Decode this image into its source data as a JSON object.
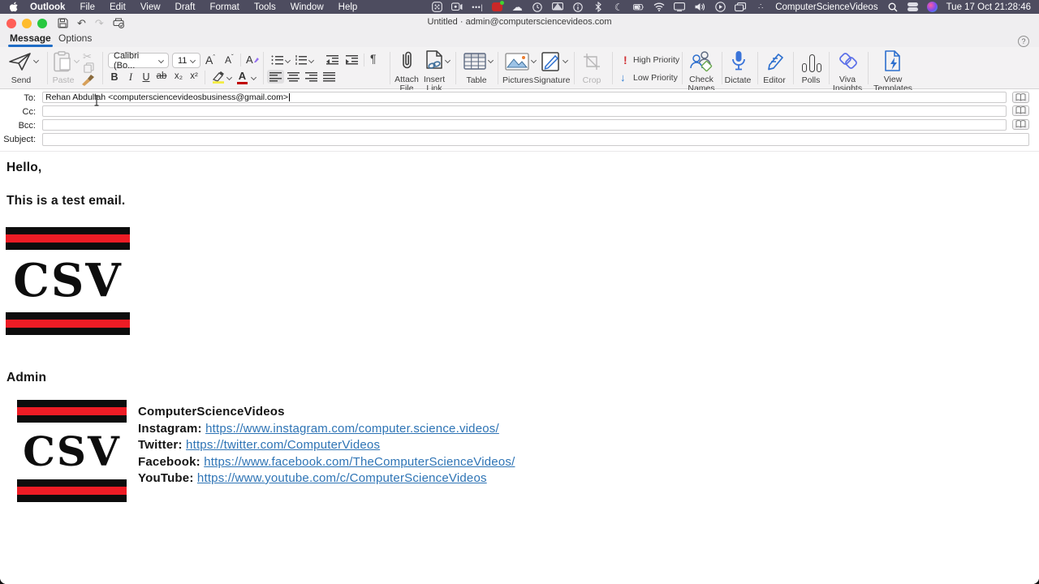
{
  "menubar": {
    "items": [
      "Outlook",
      "File",
      "Edit",
      "View",
      "Draft",
      "Format",
      "Tools",
      "Window",
      "Help"
    ],
    "status_app": "ComputerScienceVideos",
    "clock": "Tue 17 Oct 21:28:46",
    "ellipsis_glyph": "•••|",
    "dots_glyph": "∴",
    "cloud_glyph": "☁",
    "moon_glyph": "☾"
  },
  "titlebar": {
    "title": "Untitled · admin@computersciencevideos.com"
  },
  "tabs": {
    "message": "Message",
    "options": "Options",
    "help_glyph": "?"
  },
  "ribbon": {
    "send_label": "Send",
    "paste_label": "Paste",
    "font_name": "Calibri (Bo...",
    "font_size": "11",
    "grow_letter": "A",
    "shrink_letter": "A",
    "styles_letter": "A",
    "bold": "B",
    "italic": "I",
    "underline": "U",
    "strikethrough": "ab",
    "subscript": "x₂",
    "superscript": "x²",
    "font_color_letter": "A",
    "pilcrow": "¶",
    "cut_glyph": "✂",
    "undo_glyph": "↶",
    "redo_glyph": "↷",
    "attach_file": [
      "Attach",
      "File"
    ],
    "insert_link": [
      "Insert",
      "Link"
    ],
    "table_label": "Table",
    "pictures_label": "Pictures",
    "signature_label": "Signature",
    "crop_label": "Crop",
    "high_priority": "High Priority",
    "low_priority": "Low Priority",
    "exclaim_glyph": "!",
    "down_arrow_glyph": "↓",
    "check_names": [
      "Check",
      "Names"
    ],
    "dictate_label": "Dictate",
    "editor_label": "Editor",
    "polls_label": "Polls",
    "viva_insights": [
      "Viva",
      "Insights"
    ],
    "view_templates": [
      "View",
      "Templates"
    ]
  },
  "fields": {
    "to_label": "To:",
    "to_value": "Rehan Abdullah <computersciencevideosbusiness@gmail.com>",
    "cc_label": "Cc:",
    "cc_value": "",
    "bcc_label": "Bcc:",
    "bcc_value": "",
    "subject_label": "Subject:",
    "subject_value": ""
  },
  "body": {
    "greeting": "Hello,",
    "line1": "This is a test email.",
    "signoff": "Admin",
    "logo_text": "CSV"
  },
  "signature": {
    "name": "ComputerScienceVideos",
    "links": [
      {
        "label": "Instagram:",
        "url": "https://www.instagram.com/computer.science.videos/"
      },
      {
        "label": "Twitter:",
        "url": "https://twitter.com/ComputerVideos"
      },
      {
        "label": "Facebook:",
        "url": "https://www.facebook.com/TheComputerScienceVideos/"
      },
      {
        "label": "YouTube:",
        "url": "https://www.youtube.com/c/ComputerScienceVideos"
      }
    ]
  },
  "colors": {
    "accent_blue": "#1f6cc5",
    "link_blue": "#2e74b5",
    "logo_red": "#ee1c25",
    "priority_red": "#d13438",
    "office_blue": "#2d6fce",
    "menubar_bg": "#4d4c5f"
  }
}
